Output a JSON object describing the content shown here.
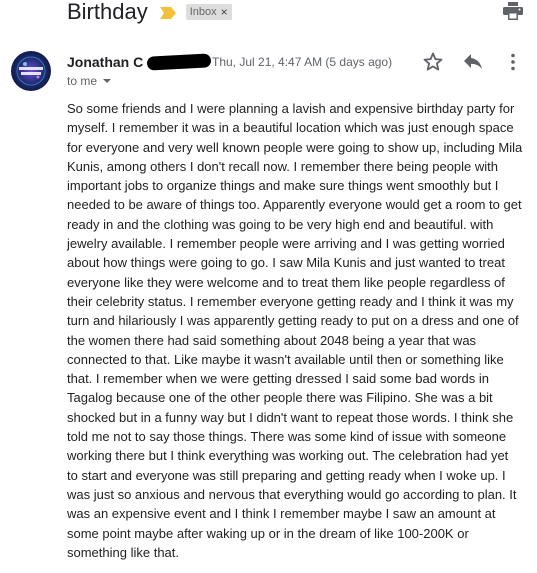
{
  "subject": "Birthday",
  "label": {
    "text": "Inbox",
    "remove": "×"
  },
  "sender": {
    "name": "Jonathan C"
  },
  "date": "Thu, Jul 21, 4:47 AM (5 days ago)",
  "recipient": "to me",
  "icons": {
    "importance": "importance-marker-icon",
    "print": "print-icon",
    "star": "star-icon",
    "reply": "reply-icon",
    "more": "more-vertical-icon",
    "avatar": "sender-avatar"
  },
  "colors": {
    "importance": "#f2c13a",
    "chip_bg": "#dddddd",
    "meta": "#5f6368"
  },
  "body_lines": [
    "So some friends and I were planning a lavish and expensive birthday party for",
    "myself. I remember it was in a beautiful location which was just enough space",
    "for everyone and very well known people were going to show up, including Mila",
    "Kunis, among others I don't recall now. I remember there being people with",
    "important jobs to organize things and make sure things went smoothly but I",
    "needed to be aware of things too. Apparently everyone would get a room to get",
    "ready in and the clothing was going to be very high end and beautiful. with",
    "jewelry available. I remember people were arriving and I was getting worried",
    "about how things were going to go. I saw Mila Kunis and just wanted to treat",
    "everyone like they were welcome and to treat them like people regardless of",
    "their celebrity status. I remember everyone getting ready and I think it was my",
    "turn and hilariously I was apparently getting ready to put on a dress and one of",
    "the women there had said something about 2048 being a year that was",
    "connected to that. Like maybe it wasn't available until then or something like",
    "that. I remember when we were getting dressed I said some bad words in",
    "Tagalog because one of the other people there was Filipino. She was a bit",
    "shocked but in a funny way but I didn't want to repeat those words. I think she",
    "told me not to say those things. There was some kind of issue with someone",
    "working there but I think everything was working out. The celebration had yet",
    "to start and everyone was still preparing and getting ready when I woke up. I",
    "was just so anxious and nervous that everything would go according to plan. It",
    "was an expensive event and I think I remember maybe I saw an amount at",
    "some point maybe after waking up or in the dream of like 100-200K or",
    "something like that."
  ]
}
